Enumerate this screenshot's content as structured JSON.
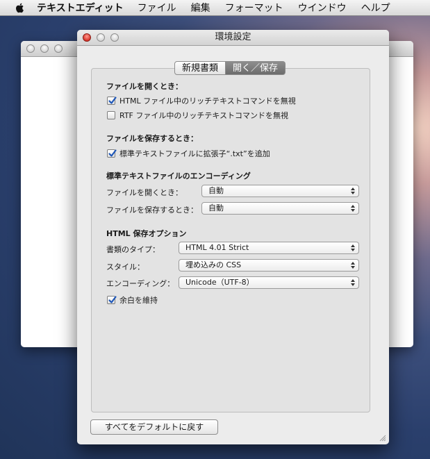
{
  "menubar": {
    "apple_icon": "apple-logo-icon",
    "app_name": "テキストエディット",
    "items": [
      "ファイル",
      "編集",
      "フォーマット",
      "ウインドウ",
      "ヘルプ"
    ]
  },
  "window": {
    "title": "環境設定",
    "tabs": [
      {
        "label": "新規書類",
        "selected": false
      },
      {
        "label": "開く／保存",
        "selected": true
      }
    ]
  },
  "open_section": {
    "title": "ファイルを開くとき：",
    "options": [
      {
        "label": "HTML ファイル中のリッチテキストコマンドを無視",
        "checked": true
      },
      {
        "label": "RTF ファイル中のリッチテキストコマンドを無視",
        "checked": false
      }
    ]
  },
  "save_section": {
    "title": "ファイルを保存するとき：",
    "options": [
      {
        "label": "標準テキストファイルに拡張子“.txt”を追加",
        "checked": true
      }
    ]
  },
  "encoding_section": {
    "title": "標準テキストファイルのエンコーディング",
    "open_label": "ファイルを開くとき：",
    "open_value": "自動",
    "save_label": "ファイルを保存するとき：",
    "save_value": "自動"
  },
  "html_section": {
    "title": "HTML 保存オプション",
    "doc_type_label": "書類のタイプ：",
    "doc_type_value": "HTML 4.01 Strict",
    "style_label": "スタイル：",
    "style_value": "埋め込みの CSS",
    "encoding_label": "エンコーディング：",
    "encoding_value": "Unicode（UTF-8）",
    "preserve_whitespace": {
      "label": "余白を維持",
      "checked": true
    }
  },
  "reset_button": "すべてをデフォルトに戻す",
  "colors": {
    "menubar": "#e4e4e4",
    "window_bg": "#ececec",
    "panel_bg": "#e3e3e3",
    "close_red": "#d8342b",
    "checkmark": "#1d56b8",
    "tab_selected": "#7a7a7a"
  }
}
